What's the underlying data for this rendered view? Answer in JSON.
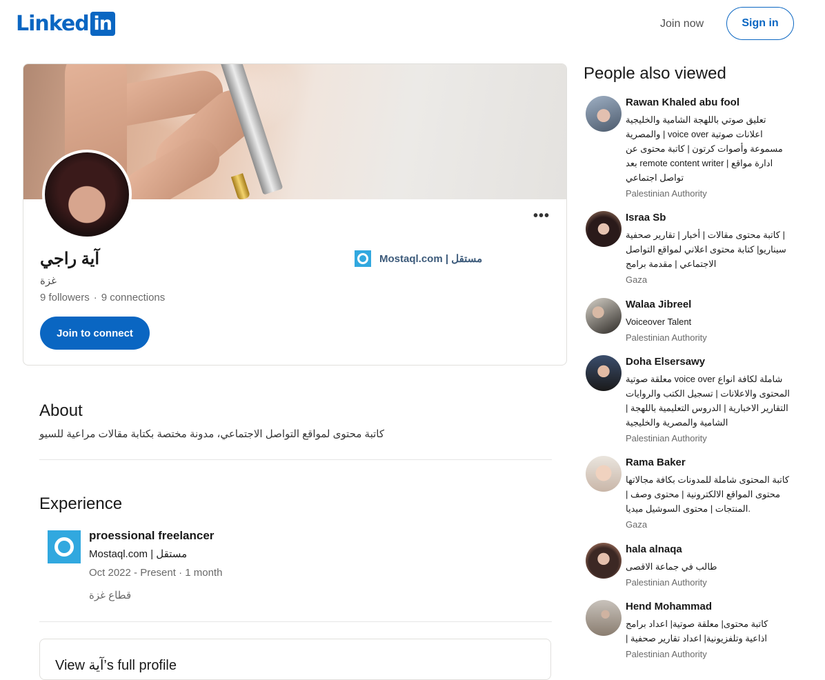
{
  "header": {
    "logo_text": "Linked",
    "logo_badge": "in",
    "join_now": "Join now",
    "sign_in": "Sign in"
  },
  "profile": {
    "name": "آية راجي",
    "location": "غزة",
    "followers": "9 followers",
    "connections": "9 connections",
    "connect_button": "Join to connect",
    "more_icon": "ellipsis-icon",
    "company": "Mostaql.com | مستقل"
  },
  "about": {
    "title": "About",
    "text": "كاتبة محتوى لمواقع التواصل الاجتماعي، مدونة مختصة بكتابة مقالات مراعية للسيو"
  },
  "experience": {
    "title": "Experience",
    "items": [
      {
        "role": "proessional freelancer",
        "company": "Mostaql.com | مستقل",
        "dates": "Oct 2022 - Present · 1 month",
        "location": "قطاع غزة"
      }
    ]
  },
  "bottom_card": {
    "title": "View آية’s full profile"
  },
  "sidebar": {
    "title": "People also viewed",
    "people": [
      {
        "name": "Rawan Khaled abu fool",
        "headline_lines": [
          "تعليق صوتي باللهجة الشامية والخليجية",
          "والمصرية | voice over اعلانات صوتية",
          "مسموعة وأصوات كرتون | كاتبة محتوى عن",
          "بعد remote content writer | ادارة مواقع",
          "تواصل اجتماعي"
        ],
        "location": "Palestinian Authority"
      },
      {
        "name": "Israa Sb",
        "headline_lines": [
          "كاتبة محتوى مقالات | أخبار | تقارير صحفية |",
          "سيناريو| كتابة محتوى اعلاني لمواقع التواصل",
          "الاجتماعي | مقدمة برامج"
        ],
        "location": "Gaza"
      },
      {
        "name": "Walaa Jibreel",
        "headline_lines": [
          "Voiceover Talent"
        ],
        "location": "Palestinian Authority"
      },
      {
        "name": "Doha Elsersawy",
        "headline_lines": [
          "معلقة صوتية voice over شاملة لكافة انواع",
          "المحتوى والاعلانات | تسجيل الكتب والروايات",
          "| التقارير الاخبارية | الدروس التعليمية باللهجة",
          "الشامية والمصرية والخليجية"
        ],
        "location": "Palestinian Authority"
      },
      {
        "name": "Rama Baker",
        "headline_lines": [
          "كاتبة المحتوى شاملة للمدونات بكافة مجالاتها",
          "| محتوى المواقع الالكترونية | محتوى وصف",
          "المنتجات | محتوى السوشيل ميديا."
        ],
        "location": "Gaza"
      },
      {
        "name": "hala alnaqa",
        "headline_lines": [
          "طالب في جماعة الاقصى"
        ],
        "location": "Palestinian Authority"
      },
      {
        "name": "Hend Mohammad",
        "headline_lines": [
          "كاتبة محتوى| معلقة صوتية| اعداد برامج",
          "| اذاعية وتلفزيونية| اعداد تقارير صحفية"
        ],
        "location": "Palestinian Authority"
      }
    ]
  },
  "colors": {
    "brand": "#0a66c2",
    "company_logo": "#31a8df"
  }
}
